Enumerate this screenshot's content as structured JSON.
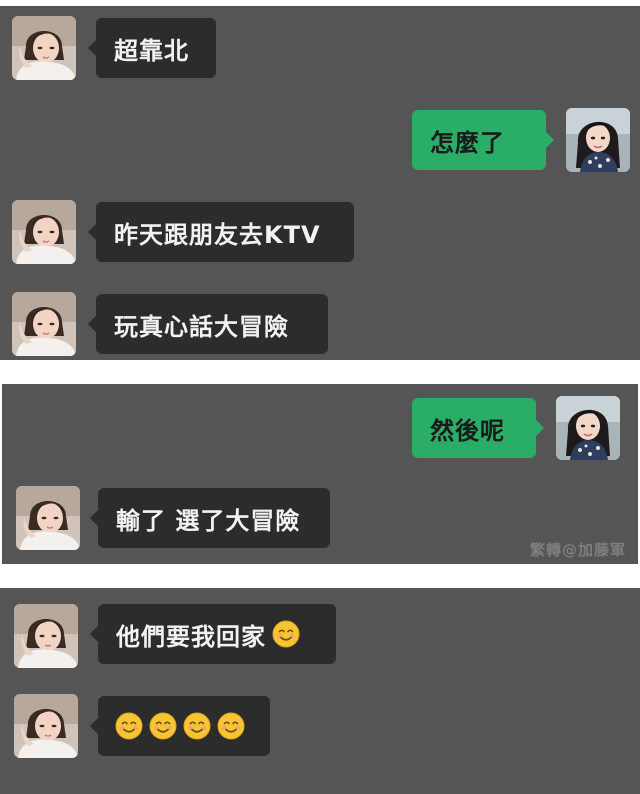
{
  "panel1": {
    "msg1": "超靠北",
    "msg2": "怎麼了",
    "msg3": "昨天跟朋友去KTV",
    "msg4": "玩真心話大冒險"
  },
  "panel2": {
    "msg1": "然後呢",
    "msg2": "輸了 選了大冒險",
    "watermark": "繁轉@加藤軍"
  },
  "panel3": {
    "msg1": "他們要我回家",
    "msg1_emoji": "smiling-face-emoji",
    "msg2_emoji_count": 4,
    "msg2_emoji": "smiling-face-emoji"
  },
  "colors": {
    "background": "#555556",
    "incoming_bubble": "#2c2c2d",
    "outgoing_bubble": "#2aae67",
    "divider": "#ffffff"
  }
}
